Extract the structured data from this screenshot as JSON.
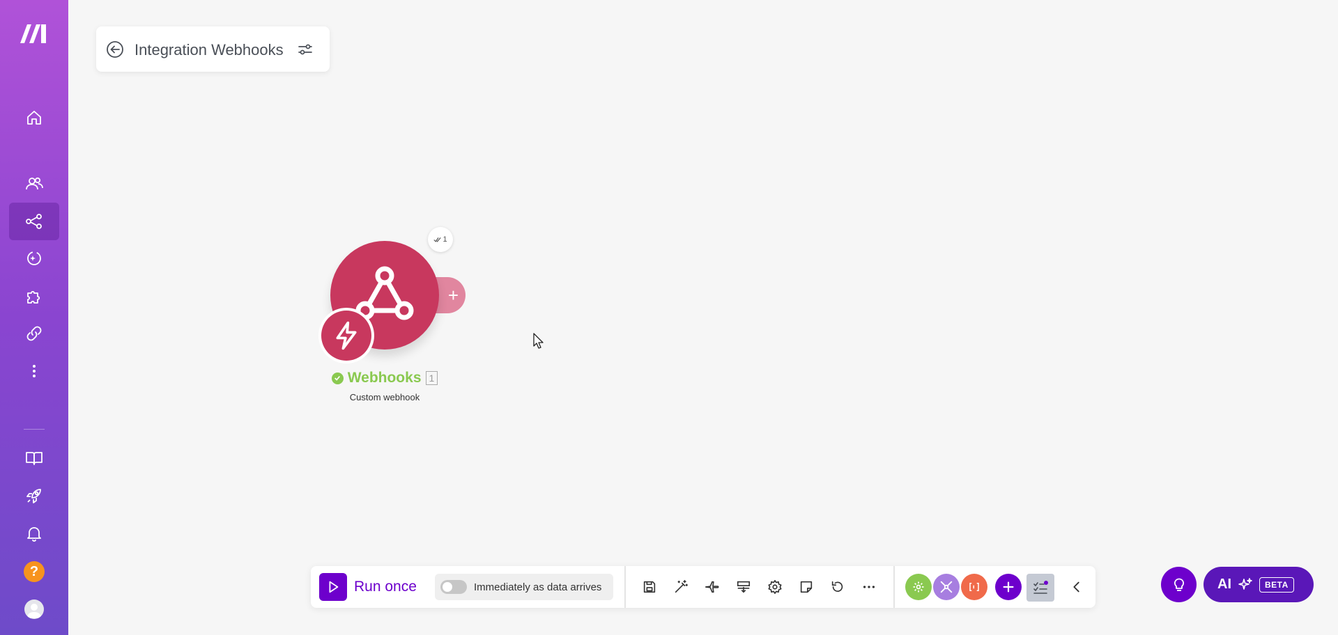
{
  "sidebar": {
    "items": [
      {
        "name": "home-icon"
      },
      {
        "name": "team-icon"
      },
      {
        "name": "scenarios-icon",
        "active": true
      },
      {
        "name": "ai-agents-icon"
      },
      {
        "name": "apps-puzzle-icon"
      },
      {
        "name": "connections-link-icon"
      },
      {
        "name": "more-vertical-icon"
      },
      {
        "name": "docs-book-icon"
      },
      {
        "name": "rocket-icon"
      },
      {
        "name": "bell-icon"
      },
      {
        "name": "help-icon"
      },
      {
        "name": "avatar"
      }
    ],
    "help_label": "?"
  },
  "header": {
    "title": "Integration Webhooks"
  },
  "module": {
    "name": "Webhooks",
    "id": "1",
    "subtitle": "Custom webhook",
    "counter": "1",
    "status": "success",
    "color": "#c8385e",
    "status_color": "#8ac950"
  },
  "toolbar": {
    "run_label": "Run once",
    "schedule_label": "Immediately as data arrives",
    "schedule_on": false,
    "tools": [
      "save-icon",
      "auto-align-wand-icon",
      "airplane-icon",
      "explain-flow-icon",
      "settings-gear-icon",
      "notes-icon",
      "undo-icon",
      "more-horizontal-icon"
    ],
    "favorites": [
      {
        "name": "tools-app-icon",
        "color": "#8ac950"
      },
      {
        "name": "flow-control-icon",
        "color": "#a77ee0"
      },
      {
        "name": "text-parser-icon",
        "color": "#f06a4a"
      }
    ],
    "accent": "#6d00cc"
  },
  "ai": {
    "label": "AI",
    "beta": "BETA"
  }
}
